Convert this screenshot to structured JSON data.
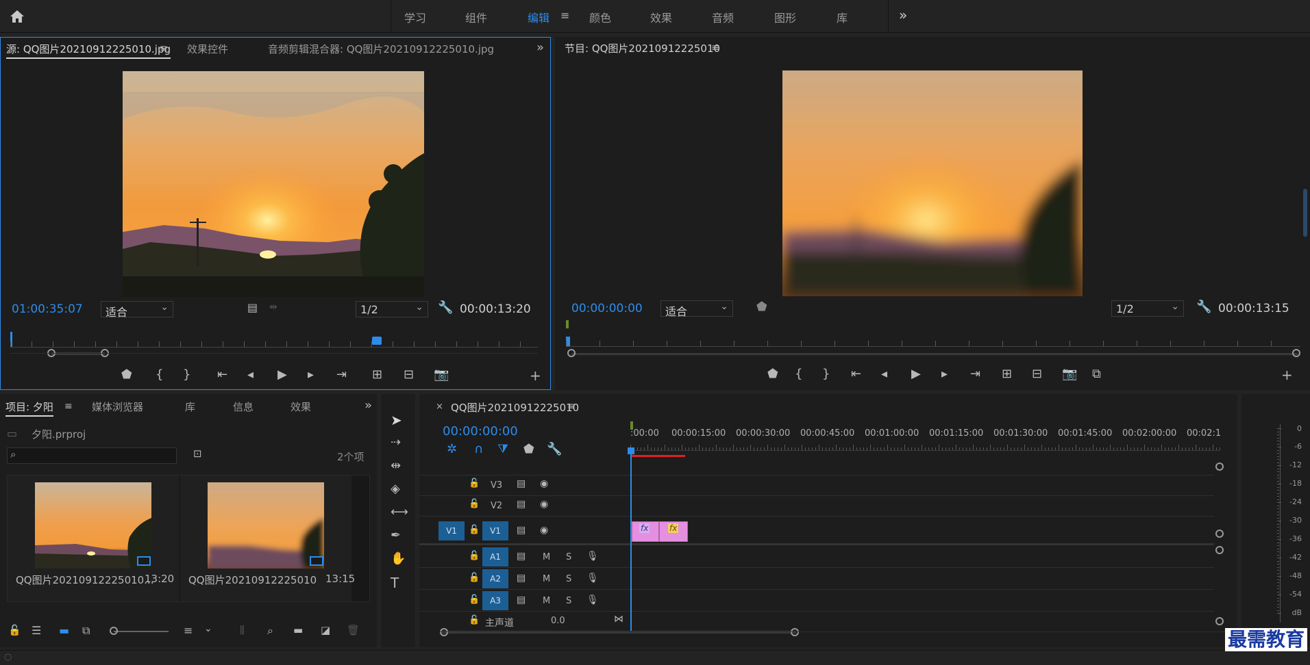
{
  "topnav": {
    "items": [
      "学习",
      "组件",
      "编辑",
      "颜色",
      "效果",
      "音频",
      "图形",
      "库"
    ],
    "active": "编辑",
    "more": "»"
  },
  "source_panel": {
    "tabs": [
      "源: QQ图片20210912225010.jpg",
      "效果控件",
      "音频剪辑混合器: QQ图片20210912225010.jpg"
    ],
    "timecode_left": "01:00:35:07",
    "zoom": "适合",
    "resolution": "1/2",
    "timecode_right": "00:00:13:20"
  },
  "program_panel": {
    "title": "节目: QQ图片20210912225010",
    "timecode_left": "00:00:00:00",
    "zoom": "适合",
    "resolution": "1/2",
    "timecode_right": "00:00:13:15"
  },
  "project_panel": {
    "tabs": [
      "项目: 夕阳",
      "媒体浏览器",
      "库",
      "信息",
      "效果"
    ],
    "project_file": "夕阳.prproj",
    "item_count": "2个项",
    "search_placeholder": "",
    "items": [
      {
        "name": "QQ图片20210912225010...",
        "duration": "13:20"
      },
      {
        "name": "QQ图片20210912225010",
        "duration": "13:15"
      }
    ]
  },
  "timeline": {
    "title": "QQ图片20210912225010",
    "timecode": "00:00:00:00",
    "ruler": [
      ":00:00",
      "00:00:15:00",
      "00:00:30:00",
      "00:00:45:00",
      "00:01:00:00",
      "00:01:15:00",
      "00:01:30:00",
      "00:01:45:00",
      "00:02:00:00",
      "00:02:1"
    ],
    "video_tracks": [
      "V3",
      "V2",
      "V1"
    ],
    "audio_tracks": [
      "A1",
      "A2",
      "A3"
    ],
    "track_m": "M",
    "track_s": "S",
    "src_patch": "V1",
    "master_label": "主声道",
    "master_value": "0.0",
    "fx_label": "fx"
  },
  "audio_meter": {
    "labels": [
      "0",
      "-6",
      "-12",
      "-18",
      "-24",
      "-30",
      "-36",
      "-42",
      "-48",
      "-54",
      "dB"
    ]
  },
  "watermark": "最需教育",
  "colors": {
    "accent": "#2d8ceb",
    "clip": "#e58fe0",
    "track_blue": "#1c5f95",
    "playhead_red": "#e02020"
  }
}
